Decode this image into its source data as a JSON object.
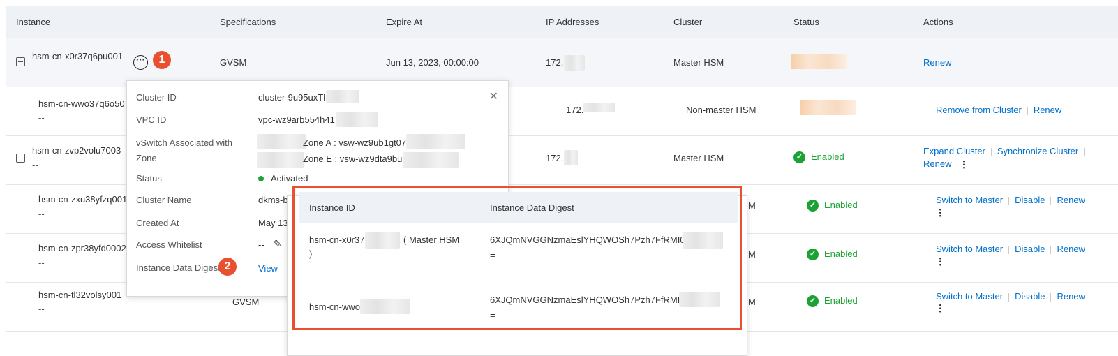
{
  "table": {
    "headers": [
      "Instance",
      "Specifications",
      "Expire At",
      "IP Addresses",
      "Cluster",
      "Status",
      "Actions"
    ],
    "rows": [
      {
        "id": "hsm-cn-x0r37q6pu001",
        "sub": "--",
        "spec": "GVSM",
        "expire": "Jun 13, 2023, 00:00:00",
        "ip": "172.",
        "cluster": "Master HSM",
        "status": "",
        "actions": [
          "Renew"
        ]
      },
      {
        "id": "hsm-cn-wwo37q6o50",
        "sub": "--",
        "spec": "",
        "expire": "",
        "ip": "172.",
        "cluster": "Non-master HSM",
        "status": "",
        "actions": [
          "Remove from Cluster",
          "Renew"
        ]
      },
      {
        "id": "hsm-cn-zvp2volu7003",
        "sub": "--",
        "spec": "",
        "expire": "",
        "ip": "172.",
        "cluster": "Master HSM",
        "status": "Enabled",
        "actions": [
          "Expand Cluster",
          "Synchronize Cluster",
          "Renew"
        ]
      },
      {
        "id": "hsm-cn-zxu38yfzq001",
        "sub": "--",
        "cluster": "M",
        "status": "Enabled",
        "actions": [
          "Switch to Master",
          "Disable",
          "Renew"
        ]
      },
      {
        "id": "hsm-cn-zpr38yfd0002",
        "sub": "--",
        "cluster": "M",
        "status": "Enabled",
        "actions": [
          "Switch to Master",
          "Disable",
          "Renew"
        ]
      },
      {
        "id": "hsm-cn-tl32volsy001",
        "sub": "--",
        "spec": "GVSM",
        "cluster": "M",
        "status": "Enabled",
        "actions": [
          "Switch to Master",
          "Disable",
          "Renew"
        ]
      }
    ]
  },
  "badges": {
    "one": "1",
    "two": "2"
  },
  "cluster_popover": {
    "cluster_id_label": "Cluster ID",
    "cluster_id": "cluster-9u95uxTl",
    "vpc_label": "VPC ID",
    "vpc": "vpc-wz9arb554h41",
    "vswitch_label": "vSwitch Associated with Zone",
    "zone_a": "Zone A : vsw-wz9ub1gt07",
    "zone_e": "Zone E : vsw-wz9dta9bu",
    "status_label": "Status",
    "status": "Activated",
    "name_label": "Cluster Name",
    "name": "dkms-b",
    "created_label": "Created At",
    "created": "May 13",
    "whitelist_label": "Access Whitelist",
    "whitelist": "--",
    "digest_label": "Instance Data Digest",
    "digest_link": "View"
  },
  "digest_popover": {
    "headers": [
      "Instance ID",
      "Instance Data Digest"
    ],
    "rows": [
      {
        "id": "hsm-cn-x0r37",
        "role": "( Master HSM",
        "role_end": ")",
        "digest": "6XJQmNVGGNzmaEslYHQWOSh7Pzh7FfRMI0",
        "digest_end": "="
      },
      {
        "id": "hsm-cn-wwo",
        "digest": "6XJQmNVGGNzmaEslYHQWOSh7Pzh7FfRMI",
        "digest_end": "="
      }
    ]
  },
  "colors": {
    "link": "#0070cc",
    "enabled": "#1aa332",
    "badge": "#e9502f"
  }
}
